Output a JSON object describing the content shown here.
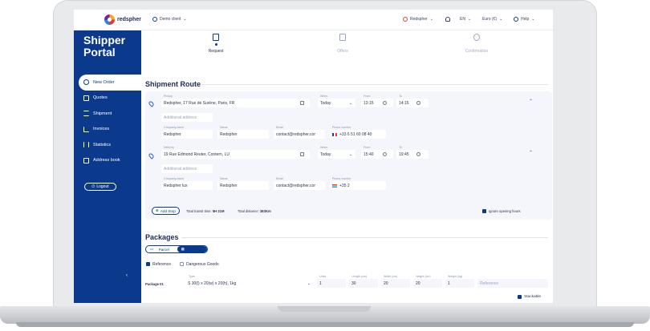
{
  "topbar": {
    "logo": "redspher",
    "client": "Demo client",
    "company": "Redspher",
    "language": "EN",
    "currency": "Euro (€)",
    "help": "Help"
  },
  "sidebar": {
    "brand_line1": "Shipper",
    "brand_line2": "Portal",
    "items": [
      {
        "label": "New Order",
        "icon": "plus-circle-icon"
      },
      {
        "label": "Quotes",
        "icon": "document-icon"
      },
      {
        "label": "Shipment",
        "icon": "list-icon"
      },
      {
        "label": "Invoices",
        "icon": "chart-icon"
      },
      {
        "label": "Statistics",
        "icon": "bar-chart-icon"
      },
      {
        "label": "Address book",
        "icon": "book-icon"
      }
    ],
    "logout": "Logout"
  },
  "steps": [
    {
      "label": "Request"
    },
    {
      "label": "Offers"
    },
    {
      "label": "Confirmation"
    }
  ],
  "route": {
    "title": "Shipment Route",
    "pickup": {
      "label": "Pickup",
      "address": "Redspher, 17 Rue de Surène, Paris, FR",
      "when_label": "When",
      "when": "Today",
      "from_label": "From",
      "from": "13:15",
      "to_label": "To",
      "to": "14:15",
      "additional": "Additional address",
      "company_label": "Company name",
      "company": "Redspher",
      "name_label": "Name",
      "name": "Redspher",
      "email_label": "Email",
      "email": "contact@redspher.cor",
      "phone_label": "Phone number",
      "phone": "+33 6 51 60 08 40"
    },
    "delivery": {
      "label": "Delivery",
      "address": "19 Rue Edmond Reuter, Contern, LU",
      "when_label": "When",
      "when": "Today",
      "from_label": "From",
      "from": "15:40",
      "to_label": "To",
      "to": "19:45",
      "additional": "Additional address",
      "company_label": "Company name",
      "company": "Redspher lux",
      "name_label": "Name",
      "name": "Redspher",
      "email_label": "Email",
      "email": "contact@redspher.cor",
      "phone_label": "Phone number",
      "phone": "+35 2"
    },
    "add_stop": "Add Stop",
    "transit_label": "Total transit time:",
    "transit": "5H 21M",
    "distance_label": "Total distance:",
    "distance": "383Km",
    "ignore_hours": "Ignore opening hours"
  },
  "packages": {
    "title": "Packages",
    "toggle_parcel": "Parcel",
    "toggle_pallet": "Pallet",
    "reference": "Reference",
    "dangerous": "Dangerous Goods",
    "row_label": "Package 01",
    "type_label": "Type",
    "type": "S 30(l) x 20(w) x 20(h), 1kg",
    "units_label": "Units",
    "units": "1",
    "length_label": "Length (cm)",
    "length": "30",
    "width_label": "Width (cm)",
    "width": "20",
    "height_label": "Height (cm)",
    "height": "20",
    "weight_label": "Weight (kg)",
    "weight": "1",
    "reference_placeholder": "Reference",
    "stackable": "Stackable"
  }
}
